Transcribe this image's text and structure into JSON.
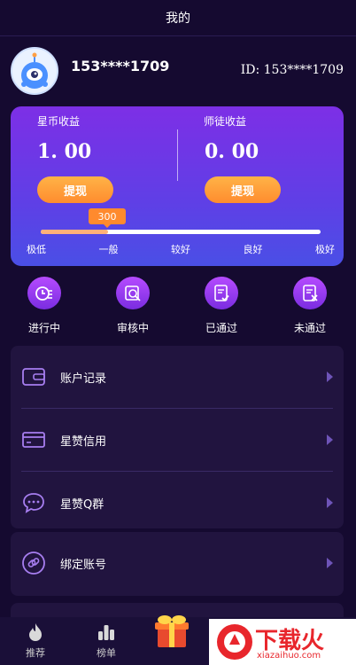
{
  "header": {
    "title": "我的"
  },
  "profile": {
    "username": "153****1709",
    "user_id": "ID: 153****1709"
  },
  "earnings": {
    "star_coin_label": "星币收益",
    "star_coin_value": "1. 00",
    "apprentice_label": "师徒收益",
    "apprentice_value": "0. 00",
    "withdraw_label": "提现"
  },
  "credit": {
    "score": "300",
    "level_fraction": 0.24,
    "levels": [
      "极低",
      "一般",
      "较好",
      "良好",
      "极好"
    ]
  },
  "statuses": [
    {
      "label": "进行中",
      "icon": "in-progress-icon"
    },
    {
      "label": "审核中",
      "icon": "reviewing-icon"
    },
    {
      "label": "已通过",
      "icon": "approved-icon"
    },
    {
      "label": "未通过",
      "icon": "rejected-icon"
    }
  ],
  "menu": [
    {
      "label": "账户记录",
      "icon": "wallet-icon"
    },
    {
      "label": "星赞信用",
      "icon": "card-icon"
    },
    {
      "label": "星赞Q群",
      "icon": "chat-icon"
    },
    {
      "label": "绑定账号",
      "icon": "link-icon"
    }
  ],
  "nav": [
    {
      "label": "推荐",
      "icon": "flame-icon"
    },
    {
      "label": "榜单",
      "icon": "bar-chart-icon"
    }
  ],
  "watermark": {
    "brand": "下载火",
    "url": "xiazaihuo.com"
  },
  "colors": {
    "background": "#150a30",
    "card_gradient_top": "#7d2fe6",
    "card_gradient_bottom": "#4a4fe6",
    "accent_orange": "#ff8c2e",
    "menu_bg": "#21143f"
  }
}
